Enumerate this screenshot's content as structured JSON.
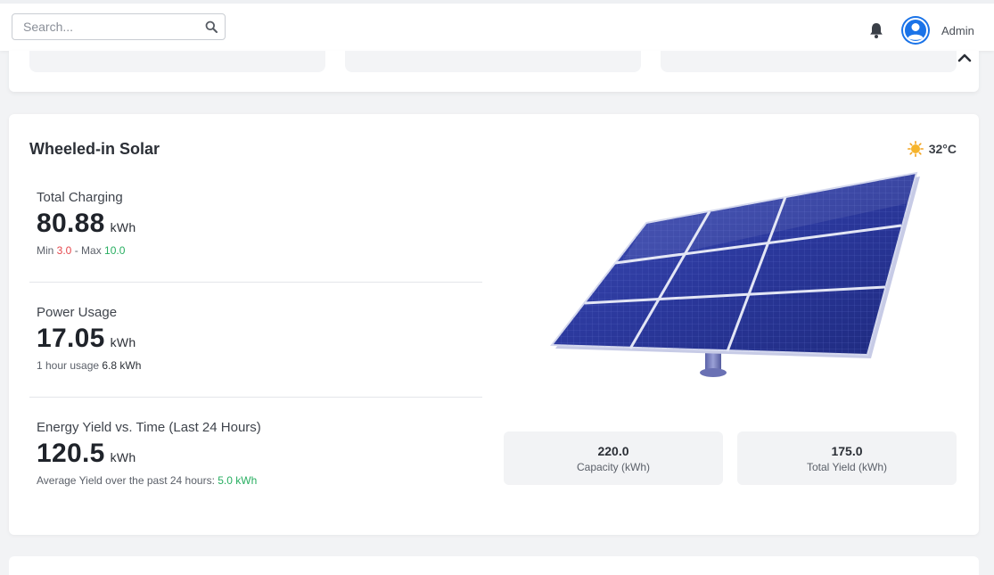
{
  "header": {
    "search_placeholder": "Search...",
    "user_name": "Admin"
  },
  "card": {
    "title": "Wheeled-in Solar",
    "temperature": "32°C",
    "metrics": [
      {
        "label": "Total Charging",
        "value": "80.88",
        "unit": "kWh",
        "sub_prefix": "Min ",
        "min": "3.0",
        "sub_mid": " - Max ",
        "max": "10.0"
      },
      {
        "label": "Power Usage",
        "value": "17.05",
        "unit": "kWh",
        "sub_prefix": "1 hour usage ",
        "sub_value": "6.8 kWh"
      },
      {
        "label": "Energy Yield vs. Time (Last 24 Hours)",
        "value": "120.5",
        "unit": "kWh",
        "sub_prefix": "Average Yield over the past 24 hours: ",
        "sub_value": "5.0 kWh"
      }
    ],
    "stats": [
      {
        "value": "220.0",
        "label": "Capacity (kWh)"
      },
      {
        "value": "175.0",
        "label": "Total Yield (kWh)"
      }
    ]
  },
  "colors": {
    "accent": "#1a73e8",
    "min_red": "#e5484d",
    "max_green": "#27ae60",
    "panel_blue": "#2b3a9a"
  }
}
